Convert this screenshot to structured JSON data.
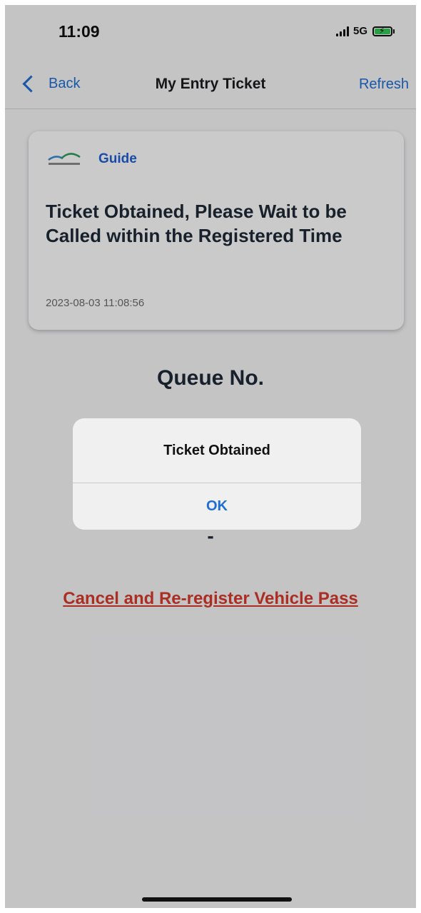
{
  "status_bar": {
    "time": "11:09",
    "network": "5G"
  },
  "nav": {
    "back_label": "Back",
    "title": "My Entry Ticket",
    "refresh_label": "Refresh"
  },
  "guide": {
    "label": "Guide",
    "message": "Ticket Obtained, Please Wait to be Called within the Registered Time",
    "timestamp": "2023-08-03 11:08:56"
  },
  "queue": {
    "title": "Queue No.",
    "number": "-"
  },
  "cancel_link": "Cancel and Re-register Vehicle Pass",
  "alert": {
    "title": "Ticket Obtained",
    "ok_label": "OK"
  },
  "colors": {
    "accent": "#1f6ed4",
    "danger": "#d7392b",
    "battery": "#34c759"
  }
}
